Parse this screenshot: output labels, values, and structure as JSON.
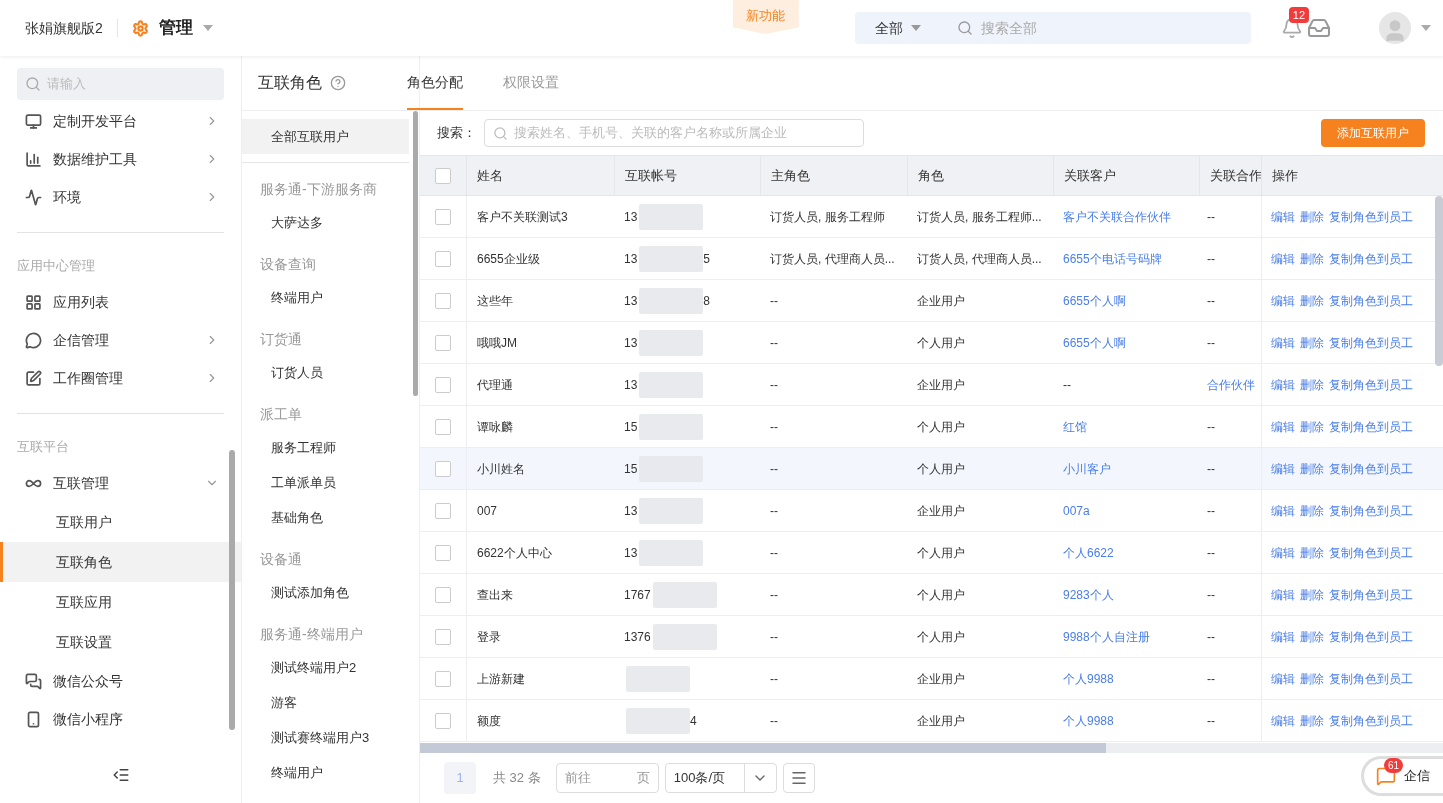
{
  "header": {
    "brand": "张娟旗舰版2",
    "module": "管理",
    "new_feature": "新功能",
    "search_scope": "全部",
    "search_placeholder": "搜索全部",
    "notification_count": "12"
  },
  "sidebar": {
    "search_placeholder": "请输入",
    "items": [
      {
        "kind": "item",
        "label": "定制开发平台",
        "expanded": false
      },
      {
        "kind": "item",
        "label": "数据维护工具",
        "expanded": false
      },
      {
        "kind": "item",
        "label": "环境",
        "expanded": false
      },
      {
        "kind": "divider"
      },
      {
        "kind": "section",
        "label": "应用中心管理"
      },
      {
        "kind": "item",
        "label": "应用列表"
      },
      {
        "kind": "item",
        "label": "企信管理",
        "expanded": false
      },
      {
        "kind": "item",
        "label": "工作圈管理",
        "expanded": false
      },
      {
        "kind": "divider"
      },
      {
        "kind": "section",
        "label": "互联平台"
      },
      {
        "kind": "item",
        "label": "互联管理",
        "expanded": true,
        "children": [
          {
            "label": "互联用户",
            "selected": false
          },
          {
            "label": "互联角色",
            "selected": true
          },
          {
            "label": "互联应用",
            "selected": false
          },
          {
            "label": "互联设置",
            "selected": false
          }
        ]
      },
      {
        "kind": "item",
        "label": "微信公众号"
      },
      {
        "kind": "item",
        "label": "微信小程序"
      }
    ]
  },
  "page": {
    "title": "互联角色",
    "tabs": [
      {
        "label": "角色分配",
        "selected": true
      },
      {
        "label": "权限设置",
        "selected": false
      }
    ]
  },
  "role_list": [
    {
      "items": [
        {
          "label": "全部互联用户",
          "selected": true
        }
      ]
    },
    {
      "title": "服务通-下游服务商",
      "items": [
        {
          "label": "大萨达多",
          "selected": false
        }
      ]
    },
    {
      "title": "设备查询",
      "items": [
        {
          "label": "终端用户",
          "selected": false
        }
      ]
    },
    {
      "title": "订货通",
      "items": [
        {
          "label": "订货人员",
          "selected": false
        }
      ]
    },
    {
      "title": "派工单",
      "items": [
        {
          "label": "服务工程师",
          "selected": false
        },
        {
          "label": "工单派单员",
          "selected": false
        },
        {
          "label": "基础角色",
          "selected": false
        }
      ]
    },
    {
      "title": "设备通",
      "items": [
        {
          "label": "测试添加角色",
          "selected": false
        }
      ]
    },
    {
      "title": "服务通-终端用户",
      "items": [
        {
          "label": "测试终端用户2",
          "selected": false
        },
        {
          "label": "游客",
          "selected": false
        },
        {
          "label": "测试赛终端用户3",
          "selected": false
        },
        {
          "label": "终端用户",
          "selected": false
        }
      ]
    }
  ],
  "search": {
    "label": "搜索：",
    "placeholder": "搜索姓名、手机号、关联的客户名称或所属企业"
  },
  "add_button": "添加互联用户",
  "table": {
    "header_checked": false,
    "columns": [
      "姓名",
      "互联帐号",
      "主角色",
      "角色",
      "关联客户",
      "关联合作",
      "操作"
    ],
    "rows": [
      {
        "checked": false,
        "highlighted": false,
        "name": "客户不关联测试3",
        "account": "13",
        "account_end": "",
        "main_role": "订货人员, 服务工程师",
        "role": "订货人员, 服务工程师...",
        "customer": {
          "text": "客户不关联合作伙伴",
          "link": true
        },
        "partner": {
          "text": "--",
          "link": false
        },
        "actions": [
          "编辑",
          "删除",
          "复制角色到员工"
        ]
      },
      {
        "checked": false,
        "highlighted": false,
        "name": "6655企业级",
        "account": "13",
        "account_end": "5",
        "main_role": "订货人员, 代理商人员...",
        "role": "订货人员, 代理商人员...",
        "customer": {
          "text": "6655个电话号码牌",
          "link": true
        },
        "partner": {
          "text": "--",
          "link": false
        },
        "actions": [
          "编辑",
          "删除",
          "复制角色到员工"
        ]
      },
      {
        "checked": false,
        "highlighted": false,
        "name": "这些年",
        "account": "13",
        "account_end": "8",
        "main_role": "--",
        "role": "企业用户",
        "customer": {
          "text": "6655个人啊",
          "link": true
        },
        "partner": {
          "text": "--",
          "link": false
        },
        "actions": [
          "编辑",
          "删除",
          "复制角色到员工"
        ]
      },
      {
        "checked": false,
        "highlighted": false,
        "name": "哦哦JM",
        "account": "13",
        "account_end": "",
        "main_role": "--",
        "role": "个人用户",
        "customer": {
          "text": "6655个人啊",
          "link": true
        },
        "partner": {
          "text": "--",
          "link": false
        },
        "actions": [
          "编辑",
          "删除",
          "复制角色到员工"
        ]
      },
      {
        "checked": false,
        "highlighted": false,
        "name": "代理通",
        "account": "13",
        "account_end": "",
        "main_role": "--",
        "role": "企业用户",
        "customer": {
          "text": "--",
          "link": false
        },
        "partner": {
          "text": "合作伙伴",
          "link": true
        },
        "actions": [
          "编辑",
          "删除",
          "复制角色到员工"
        ]
      },
      {
        "checked": false,
        "highlighted": false,
        "name": "谭咏麟",
        "account": "15",
        "account_end": "",
        "main_role": "--",
        "role": "个人用户",
        "customer": {
          "text": "红馆",
          "link": true
        },
        "partner": {
          "text": "--",
          "link": false
        },
        "actions": [
          "编辑",
          "删除",
          "复制角色到员工"
        ]
      },
      {
        "checked": false,
        "highlighted": true,
        "name": "小川姓名",
        "account": "15",
        "account_end": "",
        "main_role": "--",
        "role": "个人用户",
        "customer": {
          "text": "小川客户",
          "link": true
        },
        "partner": {
          "text": "--",
          "link": false
        },
        "actions": [
          "编辑",
          "删除",
          "复制角色到员工"
        ]
      },
      {
        "checked": false,
        "highlighted": false,
        "name": "007",
        "account": "13",
        "account_end": "",
        "main_role": "--",
        "role": "企业用户",
        "customer": {
          "text": "007a",
          "link": true
        },
        "partner": {
          "text": "--",
          "link": false
        },
        "actions": [
          "编辑",
          "删除",
          "复制角色到员工"
        ]
      },
      {
        "checked": false,
        "highlighted": false,
        "name": "6622个人中心",
        "account": "13",
        "account_end": "",
        "main_role": "--",
        "role": "个人用户",
        "customer": {
          "text": "个人6622",
          "link": true
        },
        "partner": {
          "text": "--",
          "link": false
        },
        "actions": [
          "编辑",
          "删除",
          "复制角色到员工"
        ]
      },
      {
        "checked": false,
        "highlighted": false,
        "name": "查出来",
        "account": "1767",
        "account_end": "",
        "main_role": "--",
        "role": "个人用户",
        "customer": {
          "text": "9283个人",
          "link": true
        },
        "partner": {
          "text": "--",
          "link": false
        },
        "actions": [
          "编辑",
          "删除",
          "复制角色到员工"
        ]
      },
      {
        "checked": false,
        "highlighted": false,
        "name": "登录",
        "account": "1376",
        "account_end": "",
        "main_role": "--",
        "role": "个人用户",
        "customer": {
          "text": "9988个人自注册",
          "link": true
        },
        "partner": {
          "text": "--",
          "link": false
        },
        "actions": [
          "编辑",
          "删除",
          "复制角色到员工"
        ]
      },
      {
        "checked": false,
        "highlighted": false,
        "name": "上游新建",
        "account": "",
        "account_end": "",
        "main_role": "--",
        "role": "企业用户",
        "customer": {
          "text": "个人9988",
          "link": true
        },
        "partner": {
          "text": "--",
          "link": false
        },
        "actions": [
          "编辑",
          "删除",
          "复制角色到员工"
        ]
      },
      {
        "checked": false,
        "highlighted": false,
        "name": "额度",
        "account": "",
        "account_end": "4",
        "main_role": "--",
        "role": "企业用户",
        "customer": {
          "text": "个人9988",
          "link": true
        },
        "partner": {
          "text": "--",
          "link": false
        },
        "actions": [
          "编辑",
          "删除",
          "复制角色到员工"
        ]
      }
    ]
  },
  "pagination": {
    "page": "1",
    "total": "共 32 条",
    "goto_label": "前往",
    "goto_suffix": "页",
    "page_size": "100条/页"
  },
  "chat": {
    "count": "61",
    "label": "企信"
  }
}
